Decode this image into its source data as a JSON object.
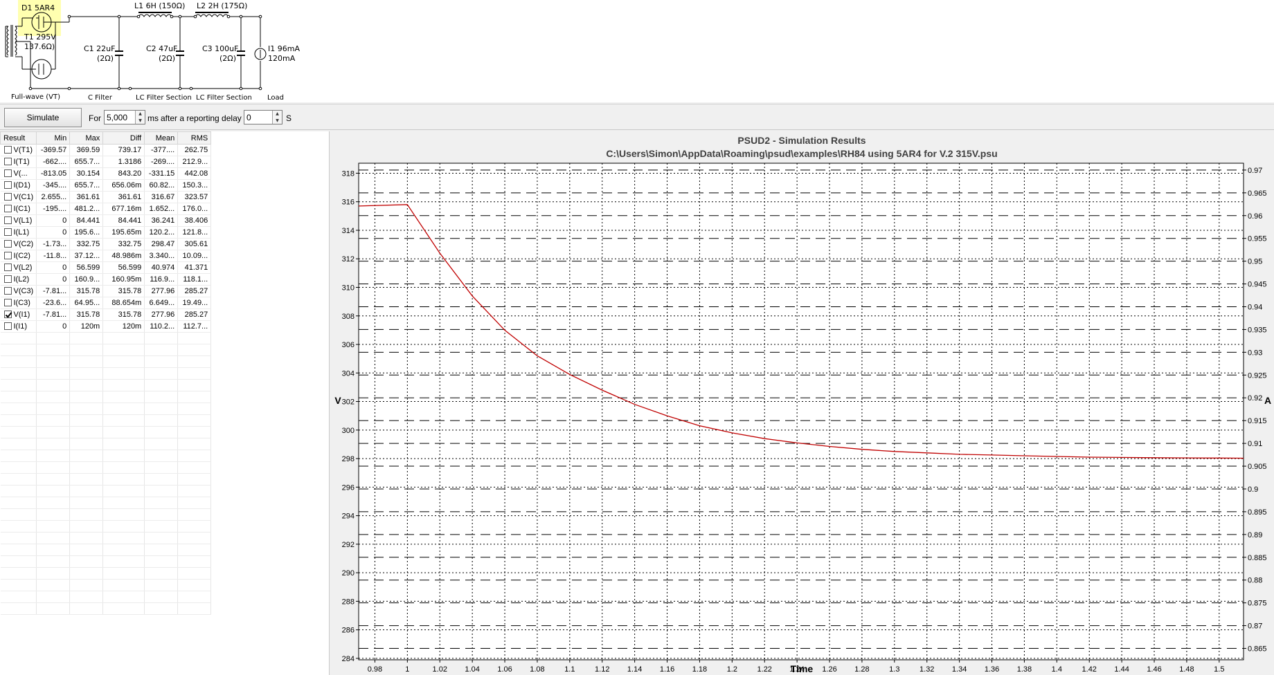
{
  "schematic": {
    "d1_label": "D1 5AR4",
    "t1_label": "T1 295V",
    "t1_res": "137.6Ω)",
    "l1_label": "L1 6H (150Ω)",
    "l2_label": "L2 2H (175Ω)",
    "c1_label": "C1 22uF",
    "c1_res": "(2Ω)",
    "c2_label": "C2 47uF",
    "c2_res": "(2Ω)",
    "c3_label": "C3 100uF",
    "c3_res": "(2Ω)",
    "i1_label": "I1 96mA",
    "i1_value": "120mA",
    "section_fullwave": "Full-wave (VT)",
    "section_cfilter": "C Filter",
    "section_lc1": "LC Filter Section",
    "section_lc2": "LC Filter Section",
    "section_load": "Load"
  },
  "toolbar": {
    "simulate_label": "Simulate",
    "for_label": "For",
    "duration_value": "5,000",
    "ms_label": "ms",
    "delay_label": "after a reporting delay of",
    "delay_value": "0",
    "s_label": "S"
  },
  "results": {
    "columns": [
      "Result",
      "Min",
      "Max",
      "Diff",
      "Mean",
      "RMS"
    ],
    "rows": [
      {
        "checked": false,
        "name": "V(T1)",
        "min": "-369.57",
        "max": "369.59",
        "diff": "739.17",
        "mean": "-377....",
        "rms": "262.75"
      },
      {
        "checked": false,
        "name": "I(T1)",
        "min": "-662....",
        "max": "655.7...",
        "diff": "1.3186",
        "mean": "-269....",
        "rms": "212.9..."
      },
      {
        "checked": false,
        "name": "V(...",
        "min": "-813.05",
        "max": "30.154",
        "diff": "843.20",
        "mean": "-331.15",
        "rms": "442.08"
      },
      {
        "checked": false,
        "name": "I(D1)",
        "min": "-345....",
        "max": "655.7...",
        "diff": "656.06m",
        "mean": "60.82...",
        "rms": "150.3..."
      },
      {
        "checked": false,
        "name": "V(C1)",
        "min": "2.655...",
        "max": "361.61",
        "diff": "361.61",
        "mean": "316.67",
        "rms": "323.57"
      },
      {
        "checked": false,
        "name": "I(C1)",
        "min": "-195....",
        "max": "481.2...",
        "diff": "677.16m",
        "mean": "1.652...",
        "rms": "176.0..."
      },
      {
        "checked": false,
        "name": "V(L1)",
        "min": "0",
        "max": "84.441",
        "diff": "84.441",
        "mean": "36.241",
        "rms": "38.406"
      },
      {
        "checked": false,
        "name": "I(L1)",
        "min": "0",
        "max": "195.6...",
        "diff": "195.65m",
        "mean": "120.2...",
        "rms": "121.8..."
      },
      {
        "checked": false,
        "name": "V(C2)",
        "min": "-1.73...",
        "max": "332.75",
        "diff": "332.75",
        "mean": "298.47",
        "rms": "305.61"
      },
      {
        "checked": false,
        "name": "I(C2)",
        "min": "-11.8...",
        "max": "37.12...",
        "diff": "48.986m",
        "mean": "3.340...",
        "rms": "10.09..."
      },
      {
        "checked": false,
        "name": "V(L2)",
        "min": "0",
        "max": "56.599",
        "diff": "56.599",
        "mean": "40.974",
        "rms": "41.371"
      },
      {
        "checked": false,
        "name": "I(L2)",
        "min": "0",
        "max": "160.9...",
        "diff": "160.95m",
        "mean": "116.9...",
        "rms": "118.1..."
      },
      {
        "checked": false,
        "name": "V(C3)",
        "min": "-7.81...",
        "max": "315.78",
        "diff": "315.78",
        "mean": "277.96",
        "rms": "285.27"
      },
      {
        "checked": false,
        "name": "I(C3)",
        "min": "-23.6...",
        "max": "64.95...",
        "diff": "88.654m",
        "mean": "6.649...",
        "rms": "19.49..."
      },
      {
        "checked": true,
        "name": "V(I1)",
        "min": "-7.81...",
        "max": "315.78",
        "diff": "315.78",
        "mean": "277.96",
        "rms": "285.27"
      },
      {
        "checked": false,
        "name": "I(I1)",
        "min": "0",
        "max": "120m",
        "diff": "120m",
        "mean": "110.2...",
        "rms": "112.7..."
      }
    ]
  },
  "chart_data": {
    "type": "line",
    "title": "PSUD2 - Simulation Results",
    "subtitle": "C:\\Users\\Simon\\AppData\\Roaming\\psud\\examples\\RH84 using 5AR4 for V.2 315V.psu",
    "xlabel": "Time",
    "ylabel": "V",
    "y2label": "A",
    "xlim": [
      0.97,
      1.515
    ],
    "ylim": [
      283.9,
      318.7
    ],
    "y2lim": [
      0.8625,
      0.9715
    ],
    "x_ticks": [
      0.98,
      1,
      1.02,
      1.04,
      1.06,
      1.08,
      1.1,
      1.12,
      1.14,
      1.16,
      1.18,
      1.2,
      1.22,
      1.24,
      1.26,
      1.28,
      1.3,
      1.32,
      1.34,
      1.36,
      1.38,
      1.4,
      1.42,
      1.44,
      1.46,
      1.48,
      1.5
    ],
    "x_tick_labels": [
      "0.98",
      "1",
      "1.02",
      "1.04",
      "1.06",
      "1.08",
      "1.1",
      "1.12",
      "1.14",
      "1.16",
      "1.18",
      "1.2",
      "1.22",
      "1.24",
      "1.26",
      "1.28",
      "1.3",
      "1.32",
      "1.34",
      "1.36",
      "1.38",
      "1.4",
      "1.42",
      "1.44",
      "1.46",
      "1.48",
      "1.5"
    ],
    "y_ticks": [
      284,
      286,
      288,
      290,
      292,
      294,
      296,
      298,
      300,
      302,
      304,
      306,
      308,
      310,
      312,
      314,
      316,
      318
    ],
    "y2_ticks": [
      0.865,
      0.87,
      0.875,
      0.88,
      0.885,
      0.89,
      0.895,
      0.9,
      0.905,
      0.91,
      0.915,
      0.92,
      0.925,
      0.93,
      0.935,
      0.94,
      0.945,
      0.95,
      0.955,
      0.96,
      0.965,
      0.97
    ],
    "y2_tick_labels": [
      "0.865",
      "0.87",
      "0.875",
      "0.88",
      "0.885",
      "0.89",
      "0.895",
      "0.9",
      "0.905",
      "0.91",
      "0.915",
      "0.92",
      "0.925",
      "0.93",
      "0.935",
      "0.94",
      "0.945",
      "0.95",
      "0.955",
      "0.96",
      "0.965",
      "0.97"
    ],
    "grid": true,
    "series": [
      {
        "name": "V(I1)",
        "color": "#c00000",
        "x": [
          0.97,
          1.0,
          1.02,
          1.04,
          1.06,
          1.08,
          1.1,
          1.12,
          1.14,
          1.16,
          1.18,
          1.2,
          1.22,
          1.24,
          1.26,
          1.28,
          1.3,
          1.32,
          1.34,
          1.36,
          1.38,
          1.4,
          1.42,
          1.44,
          1.46,
          1.48,
          1.5,
          1.515
        ],
        "y": [
          315.7,
          315.8,
          312.4,
          309.4,
          307.0,
          305.2,
          303.9,
          302.8,
          301.8,
          301.0,
          300.3,
          299.8,
          299.4,
          299.1,
          298.85,
          298.65,
          298.5,
          298.4,
          298.3,
          298.25,
          298.2,
          298.15,
          298.1,
          298.08,
          298.06,
          298.05,
          298.04,
          298.03
        ]
      }
    ]
  }
}
